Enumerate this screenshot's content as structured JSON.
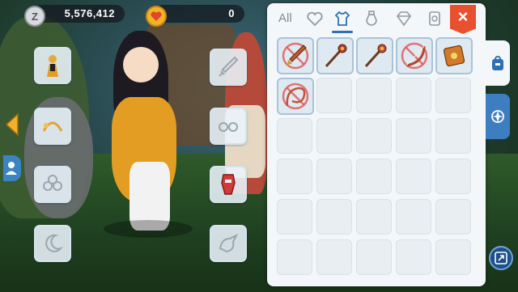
{
  "currency": {
    "zeny": "5,576,412",
    "premium": "0"
  },
  "inventory": {
    "tab_all_label": "All",
    "tabs": [
      {
        "icon": "heart-icon",
        "active": false
      },
      {
        "icon": "shirt-icon",
        "active": true
      },
      {
        "icon": "potion-icon",
        "active": false
      },
      {
        "icon": "gem-icon",
        "active": false
      },
      {
        "icon": "card-icon",
        "active": false
      }
    ],
    "close_label": "×",
    "columns": 5,
    "rows": 6,
    "items": [
      {
        "icon": "sword-icon",
        "color": "#c25a2a",
        "unusable": true
      },
      {
        "icon": "rod-icon",
        "color": "#b5402a",
        "unusable": false
      },
      {
        "icon": "rod-icon",
        "color": "#c8502e",
        "unusable": false
      },
      {
        "icon": "bow-icon",
        "color": "#b3472a",
        "unusable": true
      },
      {
        "icon": "book-icon",
        "color": "#d07a2a",
        "unusable": false
      },
      {
        "icon": "whip-icon",
        "color": "#b8583a",
        "unusable": true
      }
    ]
  },
  "equipment": {
    "left_slots": [
      "costume-icon",
      "headband-icon",
      "flower-icon",
      "moon-icon"
    ],
    "right_slots": [
      "sword-outline-icon",
      "glasses-icon",
      "armor-red-icon",
      "bird-icon"
    ]
  },
  "colors": {
    "accent_blue": "#2e6fb6",
    "close_red": "#e8502f",
    "no_sign": "#e24a4a"
  }
}
